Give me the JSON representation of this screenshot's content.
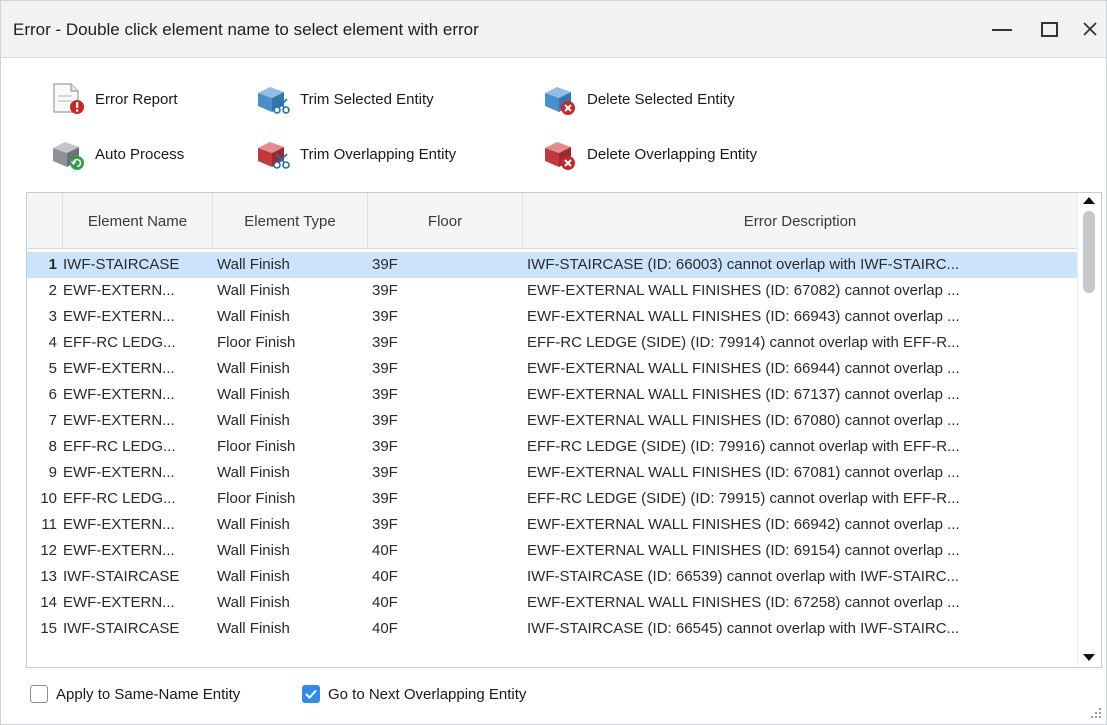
{
  "window": {
    "title": "Error - Double click element name to select element with error"
  },
  "toolbar": {
    "error_report": "Error Report",
    "trim_selected": "Trim Selected Entity",
    "delete_selected": "Delete Selected Entity",
    "auto_process": "Auto Process",
    "trim_overlapping": "Trim Overlapping Entity",
    "delete_overlapping": "Delete Overlapping Entity"
  },
  "table": {
    "headers": [
      "Element Name",
      "Element Type",
      "Floor",
      "Error Description"
    ],
    "selected_row": 1,
    "rows": [
      {
        "num": "1",
        "name": "IWF-STAIRCASE",
        "type": "Wall Finish",
        "floor": "39F",
        "desc": "IWF-STAIRCASE (ID: 66003) cannot overlap with IWF-STAIRC..."
      },
      {
        "num": "2",
        "name": "EWF-EXTERN...",
        "type": "Wall Finish",
        "floor": "39F",
        "desc": "EWF-EXTERNAL WALL FINISHES (ID: 67082) cannot overlap ..."
      },
      {
        "num": "3",
        "name": "EWF-EXTERN...",
        "type": "Wall Finish",
        "floor": "39F",
        "desc": "EWF-EXTERNAL WALL FINISHES (ID: 66943) cannot overlap ..."
      },
      {
        "num": "4",
        "name": "EFF-RC LEDG...",
        "type": "Floor Finish",
        "floor": "39F",
        "desc": "EFF-RC LEDGE (SIDE) (ID: 79914) cannot overlap with EFF-R..."
      },
      {
        "num": "5",
        "name": "EWF-EXTERN...",
        "type": "Wall Finish",
        "floor": "39F",
        "desc": "EWF-EXTERNAL WALL FINISHES (ID: 66944) cannot overlap ..."
      },
      {
        "num": "6",
        "name": "EWF-EXTERN...",
        "type": "Wall Finish",
        "floor": "39F",
        "desc": "EWF-EXTERNAL WALL FINISHES (ID: 67137) cannot overlap ..."
      },
      {
        "num": "7",
        "name": "EWF-EXTERN...",
        "type": "Wall Finish",
        "floor": "39F",
        "desc": "EWF-EXTERNAL WALL FINISHES (ID: 67080) cannot overlap ..."
      },
      {
        "num": "8",
        "name": "EFF-RC LEDG...",
        "type": "Floor Finish",
        "floor": "39F",
        "desc": "EFF-RC LEDGE (SIDE) (ID: 79916) cannot overlap with EFF-R..."
      },
      {
        "num": "9",
        "name": "EWF-EXTERN...",
        "type": "Wall Finish",
        "floor": "39F",
        "desc": "EWF-EXTERNAL WALL FINISHES (ID: 67081) cannot overlap ..."
      },
      {
        "num": "10",
        "name": "EFF-RC LEDG...",
        "type": "Floor Finish",
        "floor": "39F",
        "desc": "EFF-RC LEDGE (SIDE) (ID: 79915) cannot overlap with EFF-R..."
      },
      {
        "num": "11",
        "name": "EWF-EXTERN...",
        "type": "Wall Finish",
        "floor": "39F",
        "desc": "EWF-EXTERNAL WALL FINISHES (ID: 66942) cannot overlap ..."
      },
      {
        "num": "12",
        "name": "EWF-EXTERN...",
        "type": "Wall Finish",
        "floor": "40F",
        "desc": "EWF-EXTERNAL WALL FINISHES (ID: 69154) cannot overlap ..."
      },
      {
        "num": "13",
        "name": "IWF-STAIRCASE",
        "type": "Wall Finish",
        "floor": "40F",
        "desc": "IWF-STAIRCASE (ID: 66539) cannot overlap with IWF-STAIRC..."
      },
      {
        "num": "14",
        "name": "EWF-EXTERN...",
        "type": "Wall Finish",
        "floor": "40F",
        "desc": "EWF-EXTERNAL WALL FINISHES (ID: 67258) cannot overlap ..."
      },
      {
        "num": "15",
        "name": "IWF-STAIRCASE",
        "type": "Wall Finish",
        "floor": "40F",
        "desc": "IWF-STAIRCASE (ID: 66545) cannot overlap with IWF-STAIRC..."
      }
    ]
  },
  "options": {
    "apply_same_name": {
      "label": "Apply to Same-Name Entity",
      "checked": false
    },
    "go_next_overlapping": {
      "label": "Go to Next Overlapping Entity",
      "checked": true
    }
  },
  "colors": {
    "selection": "#cce4fb",
    "checkbox_accent": "#2f8ceb",
    "error_red": "#c62828",
    "entity_blue": "#4a90c8",
    "entity_red": "#c0393b",
    "refresh_green": "#2e9e4a"
  },
  "icons": {
    "error_report": "document-error-icon",
    "trim_selected": "blue-block-scissors-icon",
    "delete_selected": "blue-block-delete-icon",
    "auto_process": "gray-block-refresh-icon",
    "trim_overlapping": "red-block-scissors-icon",
    "delete_overlapping": "red-block-delete-icon"
  }
}
